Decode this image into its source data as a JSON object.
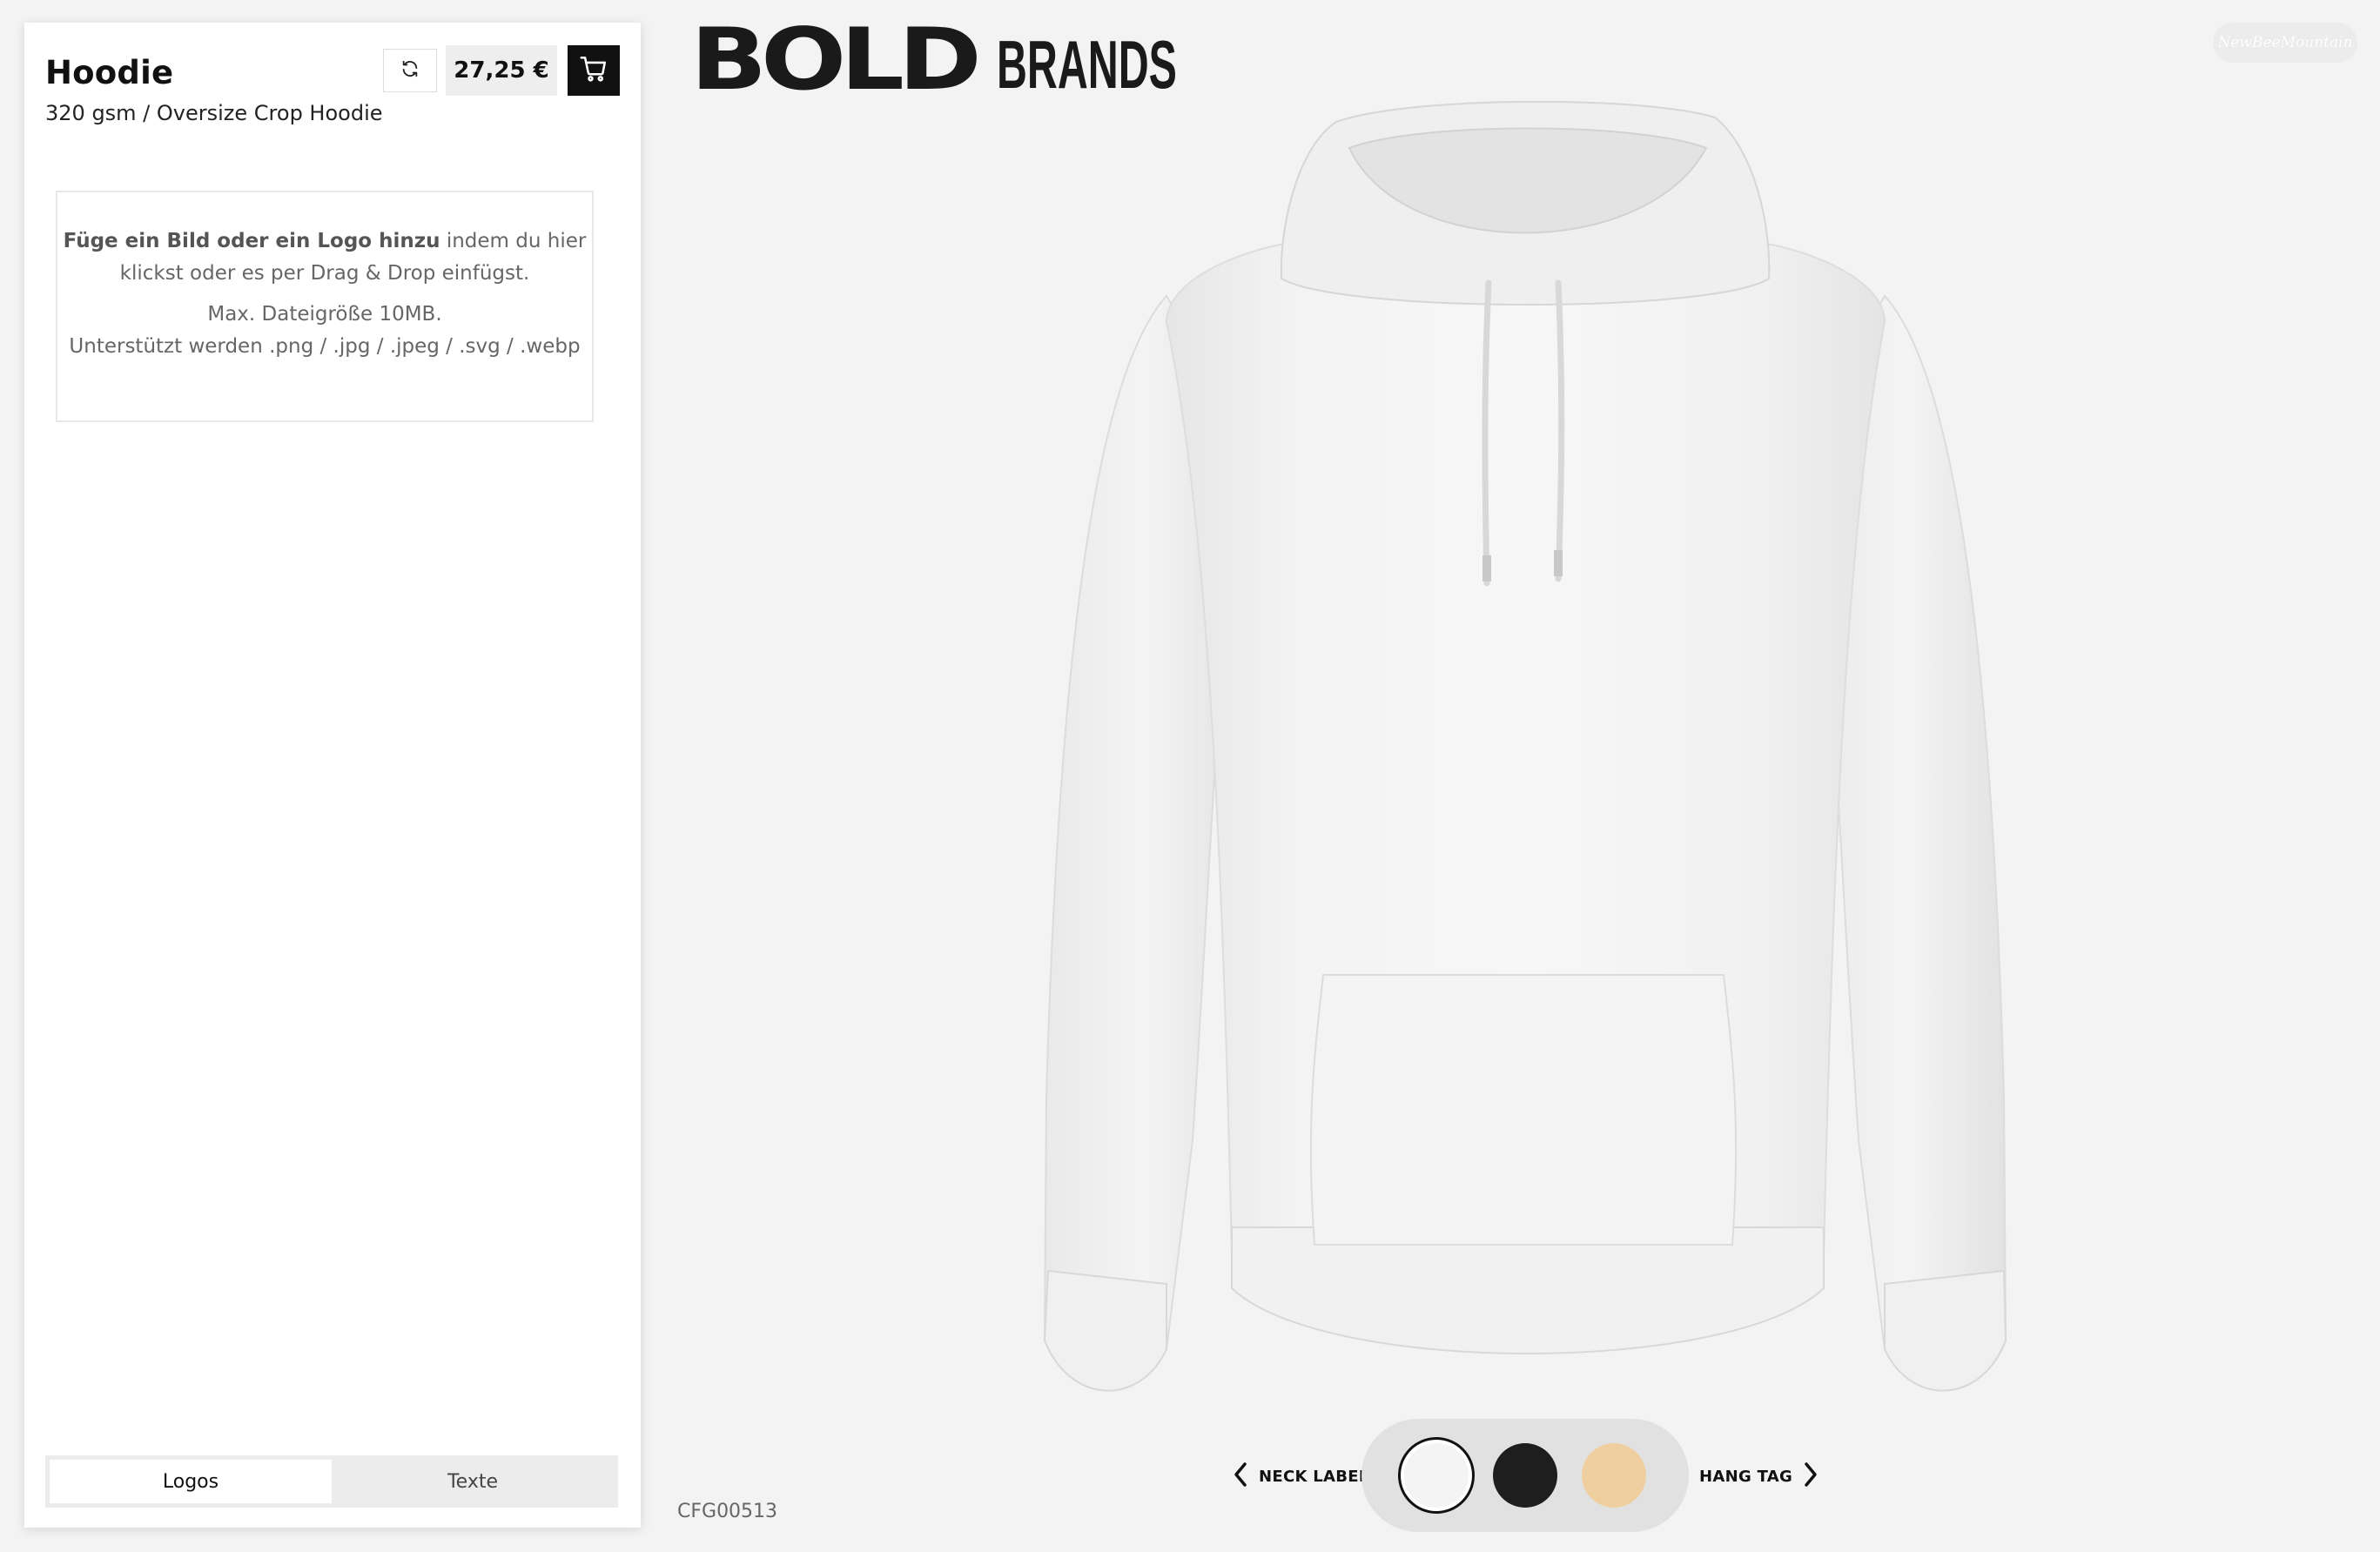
{
  "product": {
    "title": "Hoodie",
    "subtitle": "320 gsm / Oversize Crop Hoodie",
    "price": "27,25 €"
  },
  "upload": {
    "lead_bold": "Füge ein Bild oder ein Logo hinzu",
    "lead_rest": " indem du hier",
    "line2": "klickst oder es per Drag & Drop einfügst.",
    "max_size": "Max. Dateigröße 10MB.",
    "formats": "Unterstützt werden .png / .jpg / .jpeg / .svg / .webp"
  },
  "tabs": [
    {
      "label": "Logos",
      "active": true
    },
    {
      "label": "Texte",
      "active": false
    }
  ],
  "brand": {
    "part1": "BOLD",
    "part2": "BRANDS"
  },
  "watermark": "NewBeeMountain",
  "viewer": {
    "config_id": "CFG00513",
    "nav_left": "NECK LABEL",
    "nav_right": "HANG TAG",
    "swatches": [
      {
        "name": "white",
        "color": "#f4f4f4",
        "selected": true
      },
      {
        "name": "black",
        "color": "#1e1e1e",
        "selected": false
      },
      {
        "name": "sand",
        "color": "#efcf9f",
        "selected": false
      }
    ]
  },
  "icons": {
    "reset": "refresh-icon",
    "cart": "cart-icon",
    "prev": "chevron-left-icon",
    "next": "chevron-right-icon"
  }
}
